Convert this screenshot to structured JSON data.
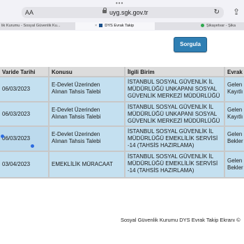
{
  "browser": {
    "aa_label": "AA",
    "url": "uyg.sgk.gov.tr",
    "tabs": [
      {
        "label": "lik Kurumu - Sosyal Güvenlik Ku..."
      },
      {
        "label": "DYS Evrak Takip"
      },
      {
        "label": "Şikayetvar - Şika"
      }
    ]
  },
  "actions": {
    "query_button": "Sorgula"
  },
  "table": {
    "headers": [
      "Varide Tarihi",
      "Konusu",
      "İlgili Birim",
      "Evrak"
    ],
    "rows": [
      {
        "date": "06/03/2023",
        "subject": [
          "E-Devlet Üzerinden",
          "Alınan Tahsis Talebi"
        ],
        "unit": [
          "İSTANBUL SOSYAL GÜVENLİK İL",
          "MÜDÜRLÜĞÜ UNKAPANI SOSYAL",
          "GÜVENLİK MERKEZİ MÜDÜRLÜĞÜ"
        ],
        "status": [
          "Gelen",
          "Kayıtlı"
        ]
      },
      {
        "date": "06/03/2023",
        "subject": [
          "E-Devlet Üzerinden",
          "Alınan Tahsis Talebi"
        ],
        "unit": [
          "İSTANBUL SOSYAL GÜVENLİK İL",
          "MÜDÜRLÜĞÜ UNKAPANI SOSYAL",
          "GÜVENLİK MERKEZİ MÜDÜRLÜĞÜ"
        ],
        "status": [
          "Gelen",
          "Kayıtlı"
        ]
      },
      {
        "date": "06/03/2023",
        "subject": [
          "E-Devlet Üzerinden",
          "Alınan Tahsis Talebi"
        ],
        "unit": [
          "İSTANBUL SOSYAL GÜVENLİK İL",
          "MÜDÜRLÜĞÜ EMEKLİLİK SERVİSİ",
          "-14 (TAHSİS HAZIRLAMA)"
        ],
        "status": [
          "Gelen",
          "Bekler"
        ]
      },
      {
        "date": "03/04/2023",
        "subject": [
          "EMEKLİLİK MÜRACAAT"
        ],
        "unit": [
          "İSTANBUL SOSYAL GÜVENLİK İL",
          "MÜDÜRLÜĞÜ EMEKLİLİK SERVİSİ",
          "-14 (TAHSİS HAZIRLAMA)"
        ],
        "status": [
          "Gelen",
          "Bekler"
        ]
      }
    ]
  },
  "footer": "Sosyal Güvenlik Kurumu DYS Evrak Takip Ekranı ©"
}
